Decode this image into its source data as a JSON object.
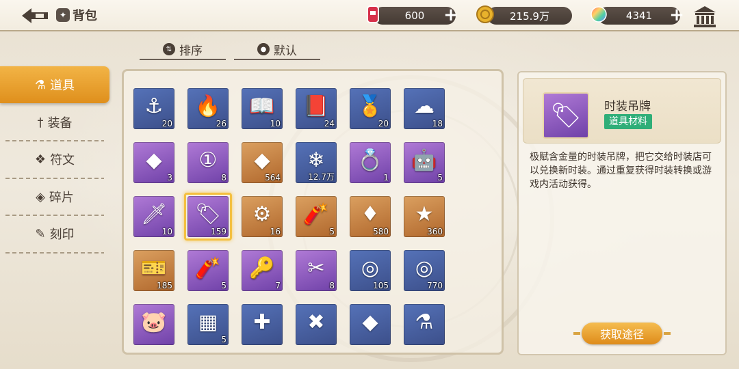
{
  "header": {
    "title": "背包",
    "resources": [
      {
        "icon": "red-gem-can-icon",
        "value": "600"
      },
      {
        "icon": "gold-coin-icon",
        "value": "215.9万"
      },
      {
        "icon": "rainbow-crystal-icon",
        "value": "4341"
      }
    ]
  },
  "sort_tabs": [
    {
      "label": "排序",
      "icon": "sort-icon"
    },
    {
      "label": "默认",
      "icon": "radio-icon"
    }
  ],
  "categories": [
    {
      "label": "道具",
      "icon": "flask-icon",
      "active": true
    },
    {
      "label": "装备",
      "icon": "sword-icon",
      "active": false
    },
    {
      "label": "符文",
      "icon": "rune-icon",
      "active": false
    },
    {
      "label": "碎片",
      "icon": "shard-icon",
      "active": false
    },
    {
      "label": "刻印",
      "icon": "seal-icon",
      "active": false
    }
  ],
  "items": [
    {
      "name": "anchor-hook",
      "count": "20",
      "rarity": "blue",
      "glyph": "⚓"
    },
    {
      "name": "lighter",
      "count": "26",
      "rarity": "blue",
      "glyph": "🔥"
    },
    {
      "name": "open-book",
      "count": "10",
      "rarity": "blue",
      "glyph": "📖"
    },
    {
      "name": "dark-tome",
      "count": "24",
      "rarity": "blue",
      "glyph": "📕"
    },
    {
      "name": "medal",
      "count": "20",
      "rarity": "blue",
      "glyph": "🏅"
    },
    {
      "name": "pillow",
      "count": "18",
      "rarity": "blue",
      "glyph": "☁"
    },
    {
      "name": "blue-crystal",
      "count": "3",
      "rarity": "purple",
      "glyph": "◆"
    },
    {
      "name": "blue-chip",
      "count": "8",
      "rarity": "purple",
      "glyph": "①"
    },
    {
      "name": "sapphire",
      "count": "564",
      "rarity": "gold",
      "glyph": "◆"
    },
    {
      "name": "clear-crystal",
      "count": "12.7万",
      "rarity": "blue",
      "glyph": "❄"
    },
    {
      "name": "ring",
      "count": "1",
      "rarity": "purple",
      "glyph": "💍"
    },
    {
      "name": "orange-mech",
      "count": "5",
      "rarity": "purple",
      "glyph": "🤖"
    },
    {
      "name": "dagger",
      "count": "10",
      "rarity": "purple",
      "glyph": "🗡"
    },
    {
      "name": "fashion-tag",
      "count": "159",
      "rarity": "purple",
      "glyph": "🏷"
    },
    {
      "name": "miner-bot",
      "count": "16",
      "rarity": "gold",
      "glyph": "⚙"
    },
    {
      "name": "dynamite",
      "count": "5",
      "rarity": "gold",
      "glyph": "🧨"
    },
    {
      "name": "red-crystal",
      "count": "580",
      "rarity": "gold",
      "glyph": "♦"
    },
    {
      "name": "gold-badge",
      "count": "360",
      "rarity": "gold",
      "glyph": "★"
    },
    {
      "name": "purple-ticket",
      "count": "185",
      "rarity": "gold",
      "glyph": "🎫"
    },
    {
      "name": "dynamite-purple",
      "count": "5",
      "rarity": "purple",
      "glyph": "🧨"
    },
    {
      "name": "golden-key",
      "count": "7",
      "rarity": "purple",
      "glyph": "🔑"
    },
    {
      "name": "pliers",
      "count": "8",
      "rarity": "purple",
      "glyph": "✂"
    },
    {
      "name": "green-orb",
      "count": "105",
      "rarity": "blue",
      "glyph": "◎"
    },
    {
      "name": "blue-orb",
      "count": "770",
      "rarity": "blue",
      "glyph": "◎"
    },
    {
      "name": "pig-bot",
      "count": "",
      "rarity": "purple",
      "glyph": "🐷"
    },
    {
      "name": "cement-bag",
      "count": "5",
      "rarity": "blue",
      "glyph": "▦"
    },
    {
      "name": "red-coin",
      "count": "",
      "rarity": "blue",
      "glyph": "✚"
    },
    {
      "name": "tools-coin",
      "count": "",
      "rarity": "blue",
      "glyph": "✖"
    },
    {
      "name": "blue-stone",
      "count": "",
      "rarity": "blue",
      "glyph": "◆"
    },
    {
      "name": "lantern",
      "count": "",
      "rarity": "blue",
      "glyph": "⚗"
    }
  ],
  "detail": {
    "name": "时装吊牌",
    "tag": "道具材料",
    "icon": "fashion-tag-icon",
    "description": "极赋含金量的时装吊牌，把它交给时装店可以兑换新时装。通过重复获得时装转换或游戏内活动获得。",
    "button": "获取途径"
  },
  "colors": {
    "accent": "#e39a25",
    "tag_green": "#2fae78"
  }
}
